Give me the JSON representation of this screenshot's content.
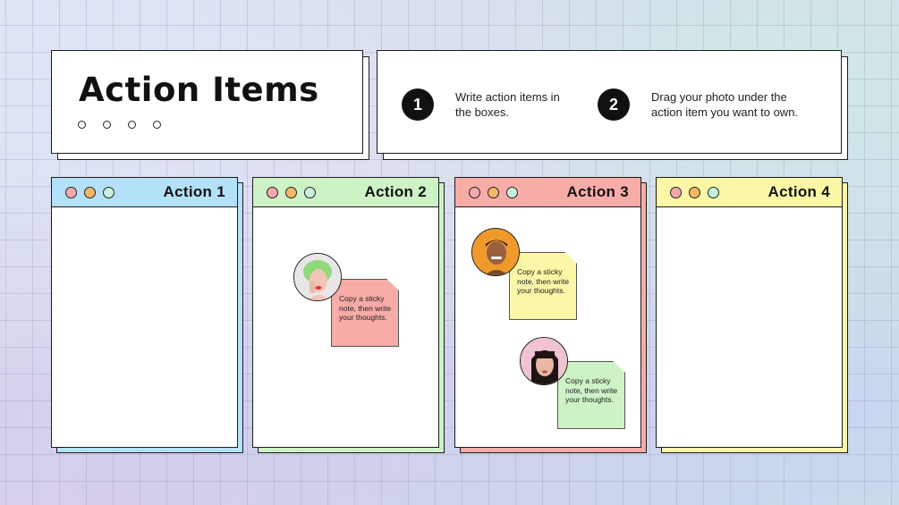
{
  "header": {
    "title": "Action Items"
  },
  "instructions": [
    {
      "number": "1",
      "text": "Write action items in the boxes."
    },
    {
      "number": "2",
      "text": "Drag your photo under the action item you want to own."
    }
  ],
  "colors": {
    "pink": "#f5a9ac",
    "orange": "#f7b766",
    "mint": "#c7f2dc",
    "blue": "#b4e0f8",
    "green": "#cdf2c6",
    "red": "#f7aca8",
    "yellow": "#fbf7a6"
  },
  "cards": [
    {
      "title": "Action 1",
      "header_color": "#b4e0f8"
    },
    {
      "title": "Action 2",
      "header_color": "#cdf2c6"
    },
    {
      "title": "Action 3",
      "header_color": "#f7aca8"
    },
    {
      "title": "Action 4",
      "header_color": "#fbf7a6"
    }
  ],
  "sticky_notes": [
    {
      "card": "Action 2",
      "text": "Copy a sticky note, then write your thoughts.",
      "color": "#f7aca8",
      "avatar": "avatar-green-hair-woman"
    },
    {
      "card": "Action 3",
      "text": "Copy a sticky note, then write your thoughts.",
      "color": "#fbf7a6",
      "avatar": "avatar-smiling-man"
    },
    {
      "card": "Action 3",
      "text": "Copy a sticky note, then write your thoughts.",
      "color": "#cdf2c6",
      "avatar": "avatar-bangs-woman"
    }
  ]
}
